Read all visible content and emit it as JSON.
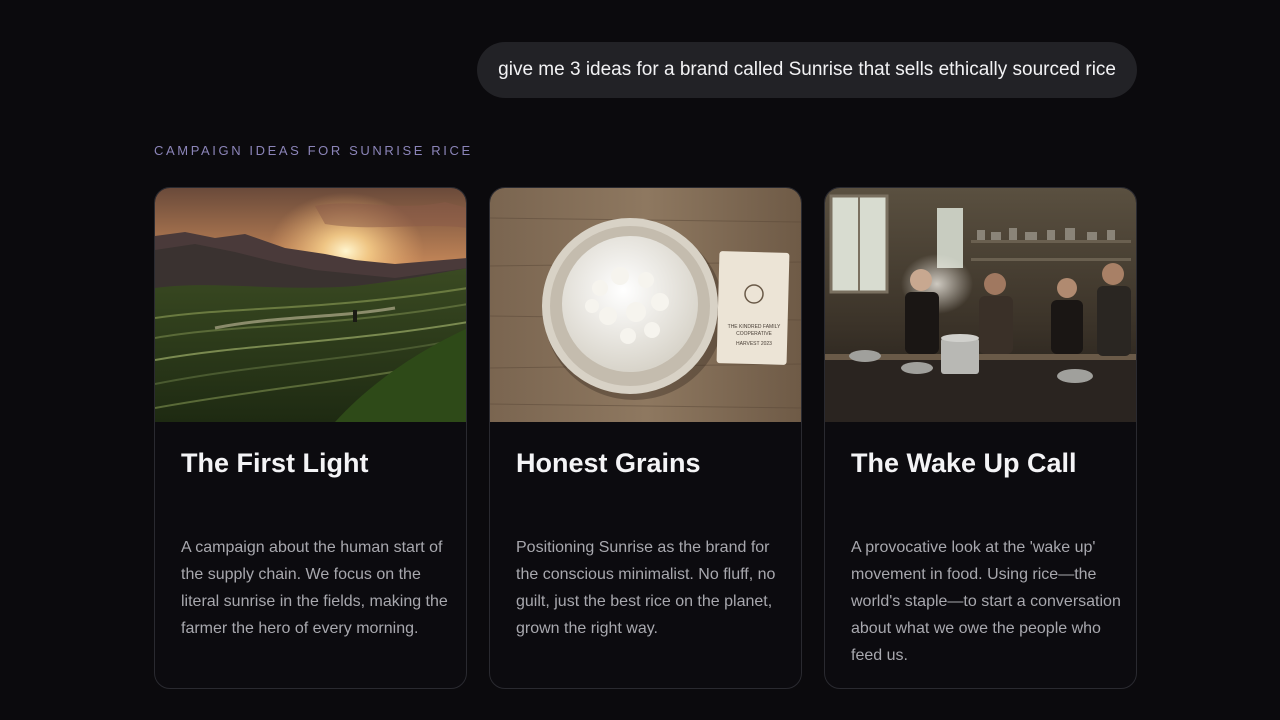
{
  "prompt": {
    "text": "give me 3 ideas for a brand called Sunrise that sells ethically sourced rice"
  },
  "section": {
    "label": "CAMPAIGN IDEAS FOR SUNRISE RICE"
  },
  "cards": [
    {
      "image": "rice-terraces-sunrise-photo",
      "title": "The First Light",
      "description": "A campaign about the human start of the supply chain. We focus on the literal sunrise in the fields, making the farmer the hero of every morning."
    },
    {
      "image": "bowl-of-rice-photo",
      "title": "Honest Grains",
      "description": "Positioning Sunrise as the brand for the conscious minimalist. No fluff, no guilt, just the best rice on the planet, grown the right way.",
      "card_text": [
        "THE KINDRED FAMILY",
        "COOPERATIVE",
        "HARVEST 2023"
      ]
    },
    {
      "image": "community-kitchen-photo",
      "title": "The Wake Up Call",
      "description": "A provocative look at the 'wake up' movement in food. Using rice—the world's staple—to start a conversation about what we owe the people who feed us."
    }
  ],
  "colors": {
    "background": "#0b0a0d",
    "bubble": "#222226",
    "label": "#8b84b8",
    "card_border": "#2a2a30"
  }
}
